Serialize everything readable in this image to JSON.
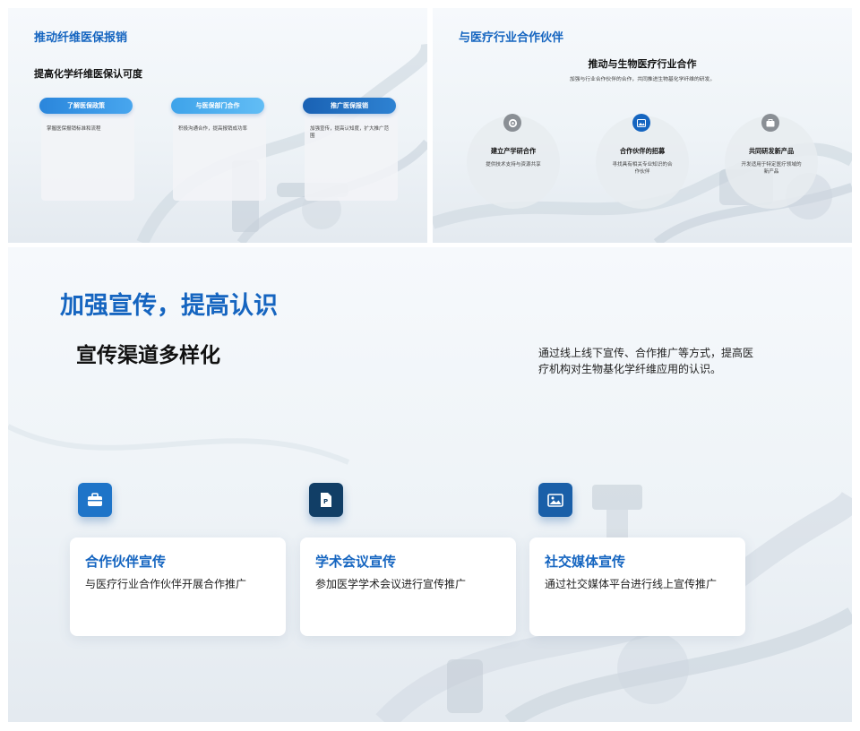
{
  "slide1": {
    "title": "推动纤维医保报销",
    "subtitle": "提高化学纤维医保认可度",
    "cards": [
      {
        "label": "了解医保政策",
        "desc": "掌握医保报销标准和流程",
        "color": "#2f8fe0"
      },
      {
        "label": "与医保部门合作",
        "desc": "积极沟通合作，提高报销成功率",
        "color": "#4aaef0"
      },
      {
        "label": "推广医保报销",
        "desc": "加强宣传，提高认知度，扩大推广范围",
        "color": "#1e6fc0"
      }
    ]
  },
  "slide2": {
    "title": "与医疗行业合作伙伴",
    "center_title": "推动与生物医疗行业合作",
    "center_desc": "加强与行业合作伙伴的合作，共同推进生物基化学纤维的研发。",
    "items": [
      {
        "title": "建立产学研合作",
        "desc": "提供技术支持与资源共享",
        "icon": "gear-icon"
      },
      {
        "title": "合作伙伴的招募",
        "desc": "寻找具有相关专业知识的合作伙伴",
        "icon": "image-icon"
      },
      {
        "title": "共同研发新产品",
        "desc": "开发适用于特定医疗领域的新产品",
        "icon": "briefcase-icon"
      }
    ]
  },
  "slide3": {
    "title": "加强宣传，提高认识",
    "subtitle": "宣传渠道多样化",
    "desc": "通过线上线下宣传、合作推广等方式，提高医疗机构对生物基化学纤维应用的认识。",
    "cards": [
      {
        "title": "合作伙伴宣传",
        "desc": "与医疗行业合作伙伴开展合作推广",
        "icon": "briefcase-icon",
        "color": "#1e74c8"
      },
      {
        "title": "学术会议宣传",
        "desc": "参加医学学术会议进行宣传推广",
        "icon": "document-icon",
        "color": "#113e66"
      },
      {
        "title": "社交媒体宣传",
        "desc": "通过社交媒体平台进行线上宣传推广",
        "icon": "image-icon",
        "color": "#1a5fa8"
      }
    ]
  }
}
